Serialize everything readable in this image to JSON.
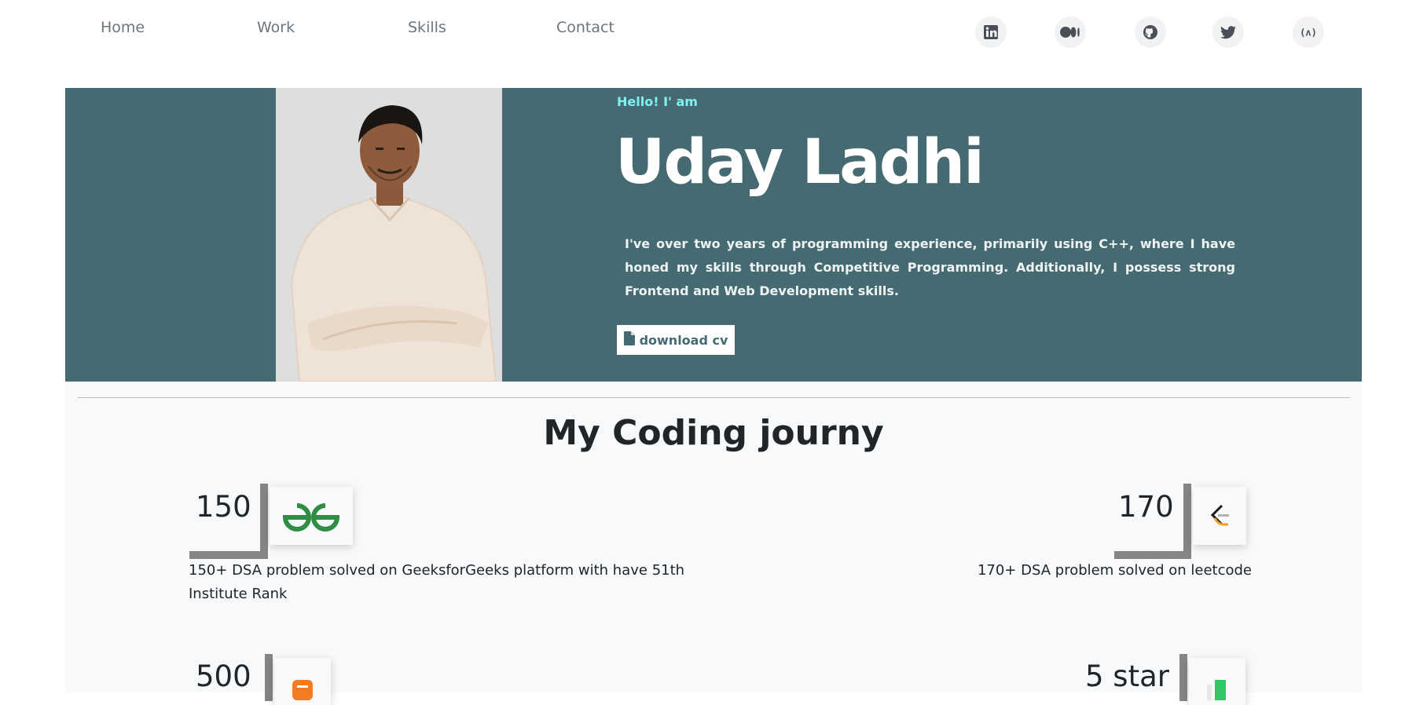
{
  "nav": {
    "links": [
      "Home",
      "Work",
      "Skills",
      "Contact"
    ]
  },
  "social": [
    {
      "name": "linkedin-icon"
    },
    {
      "name": "medium-icon"
    },
    {
      "name": "github-icon"
    },
    {
      "name": "twitter-icon"
    },
    {
      "name": "codechef-icon"
    }
  ],
  "hero": {
    "greeting": "Hello! I' am",
    "name": "Uday Ladhi",
    "intro": "I've over two years of programming experience, primarily using C++, where I have honed my skills through Competitive Programming. Additionally, I possess strong Frontend and Web Development skills.",
    "cv_button": "download cv",
    "background_color": "#456a71",
    "greeting_color": "#7ff3f3"
  },
  "journey": {
    "title": "My Coding journy",
    "stats": [
      {
        "count": "150",
        "logo": "geeksforgeeks-logo",
        "description": "150+ DSA problem solved on GeeksforGeeks platform with have 51th Institute Rank"
      },
      {
        "count": "170",
        "logo": "leetcode-logo",
        "description": "170+ DSA problem solved on leetcode"
      },
      {
        "count": "500",
        "logo": "codestudio-logo",
        "description": ""
      },
      {
        "count": "5 star",
        "logo": "hackerrank-logo",
        "description": ""
      }
    ]
  }
}
